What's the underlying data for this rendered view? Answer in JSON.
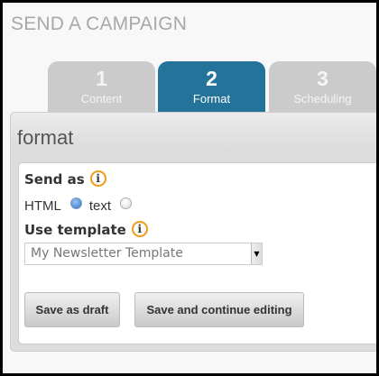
{
  "page_title": "SEND A CAMPAIGN",
  "tabs": [
    {
      "number": "1",
      "label": "Content"
    },
    {
      "number": "2",
      "label": "Format"
    },
    {
      "number": "3",
      "label": "Scheduling"
    }
  ],
  "active_tab": "Format",
  "section_heading": "format",
  "send_as": {
    "label": "Send as",
    "options": [
      "HTML",
      "text"
    ],
    "selected": "HTML"
  },
  "use_template": {
    "label": "Use template",
    "value": "My Newsletter Template"
  },
  "buttons": {
    "save_draft": "Save as draft",
    "save_continue": "Save and continue editing"
  },
  "info_glyph": "i",
  "colors": {
    "active_tab": "#23739b",
    "inactive_tab": "#cbcbcb",
    "info": "#f29a1a"
  }
}
